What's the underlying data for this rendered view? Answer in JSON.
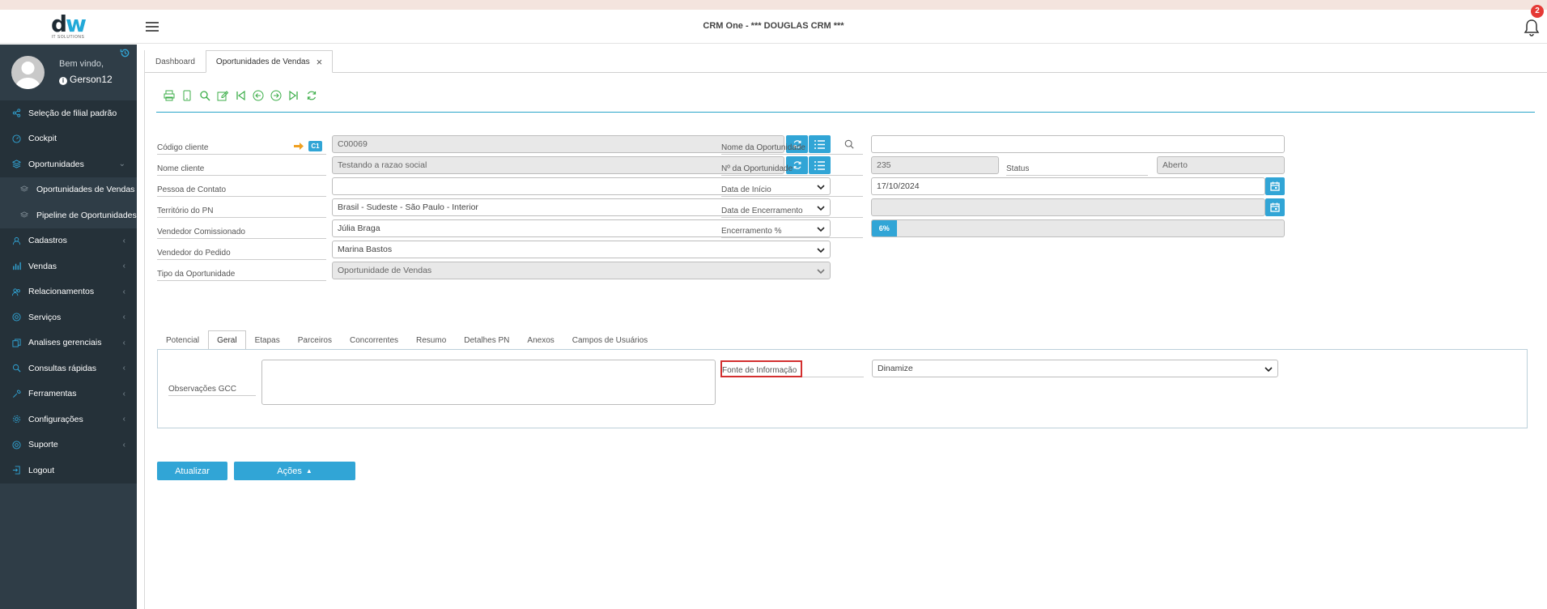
{
  "header": {
    "logo_text": "dw",
    "logo_subtitle": "IT SOLUTIONS",
    "title": "CRM One - *** DOUGLAS CRM ***",
    "notification_count": "2"
  },
  "user": {
    "welcome": "Bem vindo,",
    "name": "Gerson12"
  },
  "sidebar": {
    "items": [
      {
        "label": "Seleção de filial padrão"
      },
      {
        "label": "Cockpit"
      },
      {
        "label": "Oportunidades"
      },
      {
        "label": "Oportunidades de Vendas"
      },
      {
        "label": "Pipeline de Oportunidades"
      },
      {
        "label": "Cadastros"
      },
      {
        "label": "Vendas"
      },
      {
        "label": "Relacionamentos"
      },
      {
        "label": "Serviços"
      },
      {
        "label": "Analises gerenciais"
      },
      {
        "label": "Consultas rápidas"
      },
      {
        "label": "Ferramentas"
      },
      {
        "label": "Configurações"
      },
      {
        "label": "Suporte"
      },
      {
        "label": "Logout"
      }
    ]
  },
  "tabs": [
    {
      "label": "Dashboard"
    },
    {
      "label": "Oportunidades de Vendas"
    }
  ],
  "form": {
    "codigo_cliente": {
      "label": "Código cliente",
      "value": "C00069",
      "badge": "C1"
    },
    "nome_cliente": {
      "label": "Nome cliente",
      "value": "Testando a razao social"
    },
    "pessoa_contato": {
      "label": "Pessoa de Contato",
      "value": ""
    },
    "territorio": {
      "label": "Território do PN",
      "value": "Brasil - Sudeste - São Paulo - Interior"
    },
    "vendedor_comissionado": {
      "label": "Vendedor Comissionado",
      "value": "Júlia Braga"
    },
    "vendedor_pedido": {
      "label": "Vendedor do Pedido",
      "value": "Marina Bastos"
    },
    "tipo_oportunidade": {
      "label": "Tipo da Oportunidade",
      "value": "Oportunidade de Vendas"
    },
    "nome_oportunidade": {
      "label": "Nome da Oportunidade",
      "value": ""
    },
    "numero_oportunidade": {
      "label": "Nº da Oportunidade",
      "value": "235"
    },
    "status": {
      "label": "Status",
      "value": "Aberto"
    },
    "data_inicio": {
      "label": "Data de Início",
      "value": "17/10/2024"
    },
    "data_encerramento": {
      "label": "Data de Encerramento",
      "value": ""
    },
    "encerramento_pct": {
      "label": "Encerramento %",
      "value": "6%",
      "fraction": 0.06
    }
  },
  "detail_tabs": [
    {
      "label": "Potencial"
    },
    {
      "label": "Geral"
    },
    {
      "label": "Etapas"
    },
    {
      "label": "Parceiros"
    },
    {
      "label": "Concorrentes"
    },
    {
      "label": "Resumo"
    },
    {
      "label": "Detalhes PN"
    },
    {
      "label": "Anexos"
    },
    {
      "label": "Campos de Usuários"
    }
  ],
  "geral": {
    "observacoes_label": "Observações GCC",
    "observacoes_value": "",
    "fonte_label": "Fonte de Informação",
    "fonte_value": "Dinamize"
  },
  "actions": {
    "atualizar": "Atualizar",
    "acoes": "Ações"
  },
  "colors": {
    "accent": "#31a5d6",
    "sidebar": "#2f3d47",
    "toolbar_icon": "#3cae49",
    "highlight": "#d32f2f"
  }
}
